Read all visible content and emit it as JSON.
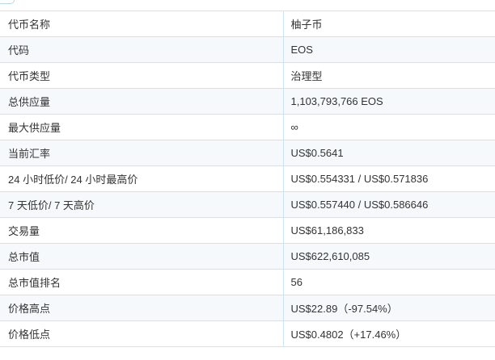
{
  "token_info": {
    "rows": [
      {
        "label": "代币名称",
        "value": "柚子币"
      },
      {
        "label": "代码",
        "value": "EOS"
      },
      {
        "label": "代币类型",
        "value": "治理型"
      },
      {
        "label": "总供应量",
        "value": "1,103,793,766 EOS"
      },
      {
        "label": "最大供应量",
        "value": "∞"
      },
      {
        "label": "当前汇率",
        "value": "US$0.5641"
      },
      {
        "label": "24 小时低价/ 24 小时最高价",
        "value": "US$0.554331 / US$0.571836"
      },
      {
        "label": "7 天低价/ 7 天高价",
        "value": "US$0.557440 / US$0.586646"
      },
      {
        "label": "交易量",
        "value": "US$61,186,833"
      },
      {
        "label": "总市值",
        "value": "US$622,610,085"
      },
      {
        "label": "总市值排名",
        "value": "56"
      },
      {
        "label": "价格高点",
        "value": "US$22.89（-97.54%）"
      },
      {
        "label": "价格低点",
        "value": "US$0.4802（+17.46%）"
      }
    ]
  }
}
